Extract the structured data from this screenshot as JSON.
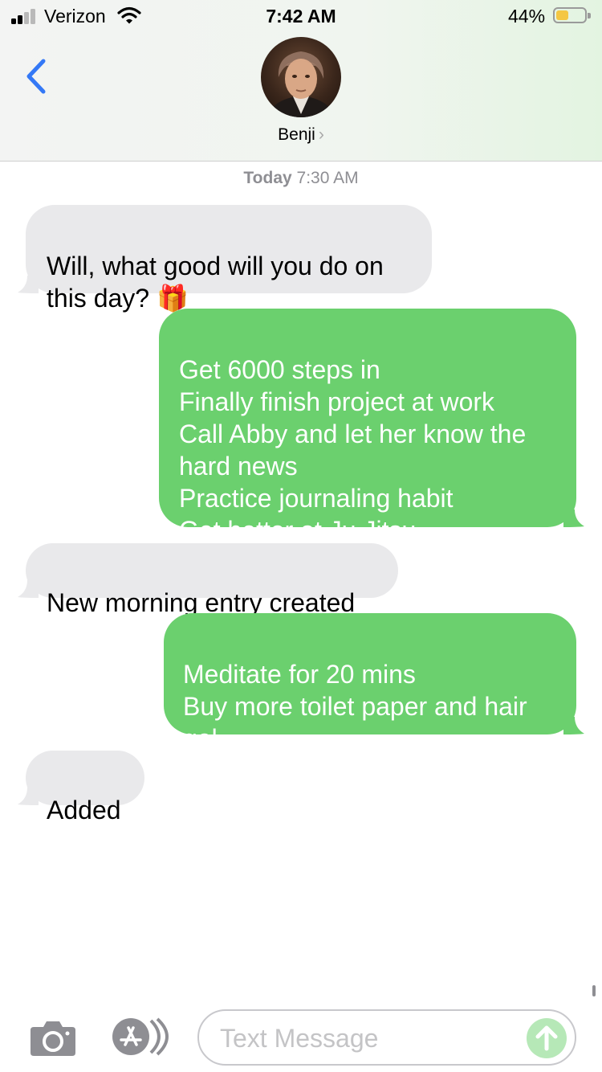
{
  "status_bar": {
    "carrier": "Verizon",
    "time": "7:42 AM",
    "battery_percent": "44%",
    "battery_level": 0.44,
    "signal_bars": 2
  },
  "header": {
    "contact_name": "Benji",
    "chevron": "›"
  },
  "thread": {
    "timestamp_day": "Today",
    "timestamp_time": "7:30 AM",
    "messages": [
      {
        "direction": "incoming",
        "text": "Will, what good will you do on\nthis day? 🎁"
      },
      {
        "direction": "outgoing",
        "text": "Get 6000 steps in\nFinally finish project at work\nCall Abby and let her know the\nhard news\nPractice journaling habit\nGet better at Ju Jitsu"
      },
      {
        "direction": "incoming",
        "text": "New morning entry created"
      },
      {
        "direction": "outgoing",
        "text": "Meditate for 20 mins\nBuy more toilet paper and hair\ngel"
      },
      {
        "direction": "incoming",
        "text": "Added"
      }
    ]
  },
  "compose": {
    "placeholder": "Text Message"
  },
  "icons": {
    "back": "chevron-left-icon",
    "camera": "camera-icon",
    "app_store": "app-store-icon",
    "send": "send-arrow-icon",
    "wifi": "wifi-icon",
    "battery": "battery-icon"
  },
  "colors": {
    "incoming_bubble": "#e9e9eb",
    "outgoing_bubble": "#6bd06e",
    "accent_blue": "#3478f6",
    "battery_fill": "#f4c744"
  }
}
